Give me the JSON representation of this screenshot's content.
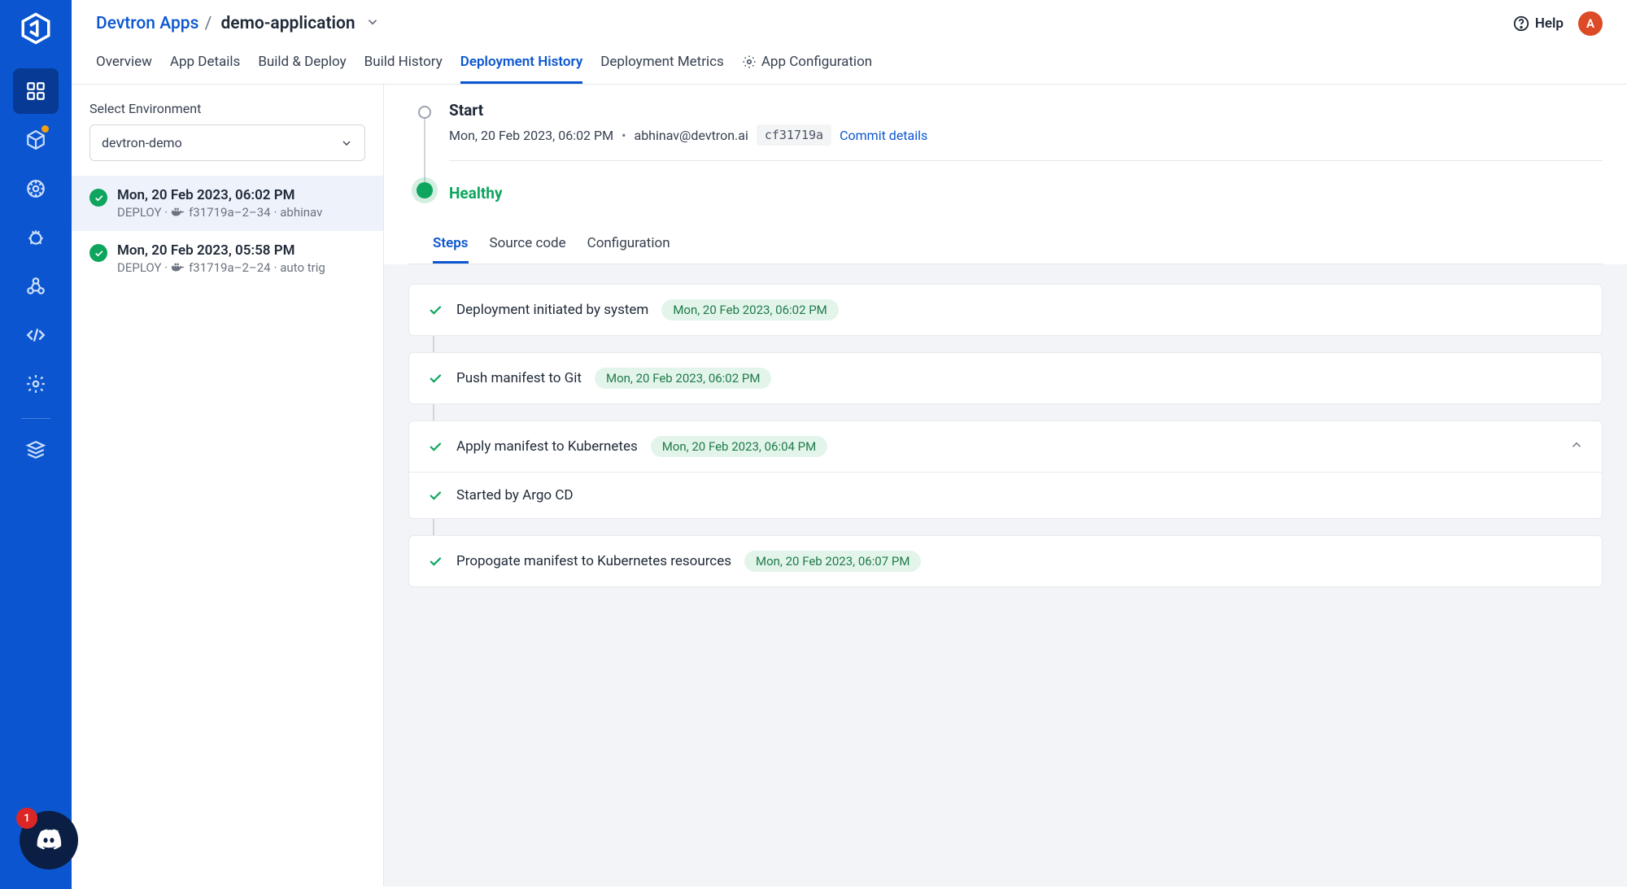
{
  "breadcrumb": {
    "root": "Devtron Apps",
    "sep": "/",
    "current": "demo-application"
  },
  "header": {
    "help": "Help",
    "avatar_initial": "A"
  },
  "top_tabs": [
    "Overview",
    "App Details",
    "Build & Deploy",
    "Build History",
    "Deployment History",
    "Deployment Metrics",
    "App Configuration"
  ],
  "env": {
    "label": "Select Environment",
    "selected": "devtron-demo"
  },
  "history": [
    {
      "title": "Mon, 20 Feb 2023, 06:02 PM",
      "meta_prefix": "DEPLOY · ",
      "meta_image": "f31719a–2–34",
      "meta_suffix": " · abhinav"
    },
    {
      "title": "Mon, 20 Feb 2023, 05:58 PM",
      "meta_prefix": "DEPLOY · ",
      "meta_image": "f31719a–2–24",
      "meta_suffix": " · auto trig"
    }
  ],
  "detail": {
    "start_label": "Start",
    "timestamp": "Mon, 20 Feb 2023, 06:02 PM",
    "author": "abhinav@devtron.ai",
    "commit": "cf31719a",
    "commit_link": "Commit details",
    "health": "Healthy"
  },
  "sub_tabs": [
    "Steps",
    "Source code",
    "Configuration"
  ],
  "steps": [
    {
      "title": "Deployment initiated by system",
      "time": "Mon, 20 Feb 2023, 06:02 PM"
    },
    {
      "title": "Push manifest to Git",
      "time": "Mon, 20 Feb 2023, 06:02 PM"
    },
    {
      "title": "Apply manifest to Kubernetes",
      "time": "Mon, 20 Feb 2023, 06:04 PM",
      "sub": "Started by Argo CD"
    },
    {
      "title": "Propogate manifest to Kubernetes resources",
      "time": "Mon, 20 Feb 2023, 06:07 PM"
    }
  ],
  "discord_badge": "1"
}
